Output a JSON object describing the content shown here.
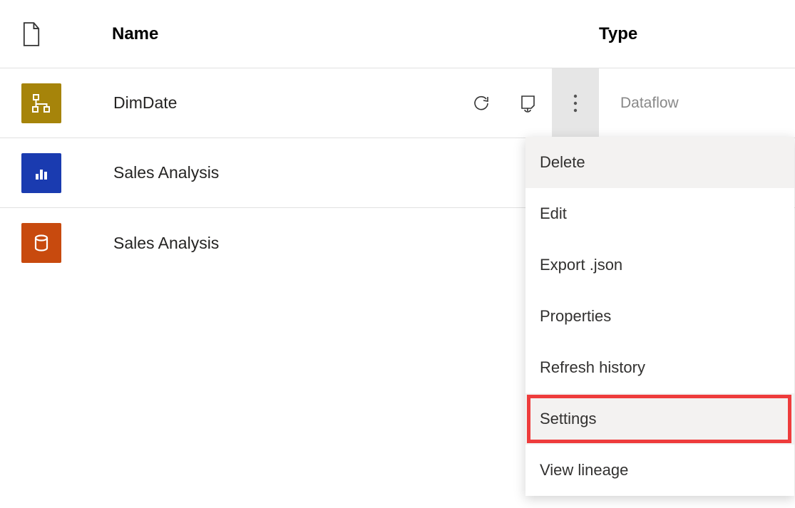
{
  "header": {
    "name_label": "Name",
    "type_label": "Type"
  },
  "rows": [
    {
      "name": "DimDate",
      "type": "Dataflow"
    },
    {
      "name": "Sales Analysis",
      "type": ""
    },
    {
      "name": "Sales Analysis",
      "type": ""
    }
  ],
  "menu": {
    "items": [
      {
        "label": "Delete"
      },
      {
        "label": "Edit"
      },
      {
        "label": "Export .json"
      },
      {
        "label": "Properties"
      },
      {
        "label": "Refresh history"
      },
      {
        "label": "Settings"
      },
      {
        "label": "View lineage"
      }
    ]
  }
}
